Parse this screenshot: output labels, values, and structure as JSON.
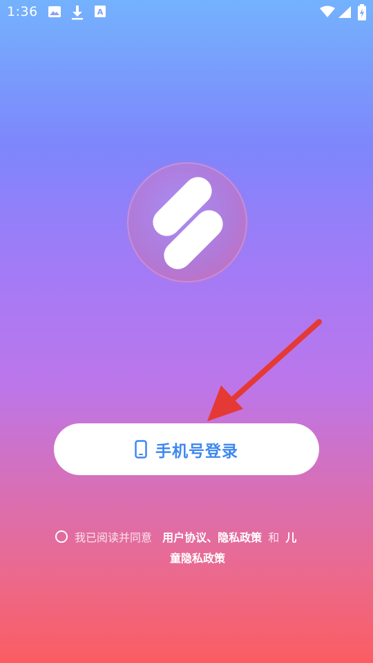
{
  "status_bar": {
    "time": "1:36"
  },
  "login": {
    "button_label": "手机号登录"
  },
  "agreement": {
    "prefix": "我已阅读并同意",
    "link_user_privacy": "用户协议、隐私政策",
    "conjunction": "和",
    "link_children_1": "儿",
    "link_children_2": "童隐私政策"
  },
  "colors": {
    "accent_blue": "#3d87f1",
    "arrow_red": "#e53935",
    "gradient_top": "#74b2fd",
    "gradient_bottom": "#fb5d61"
  },
  "icons": [
    "image-icon",
    "download-icon",
    "font-icon",
    "wifi-icon",
    "signal-icon",
    "battery-icon",
    "phone-icon"
  ]
}
